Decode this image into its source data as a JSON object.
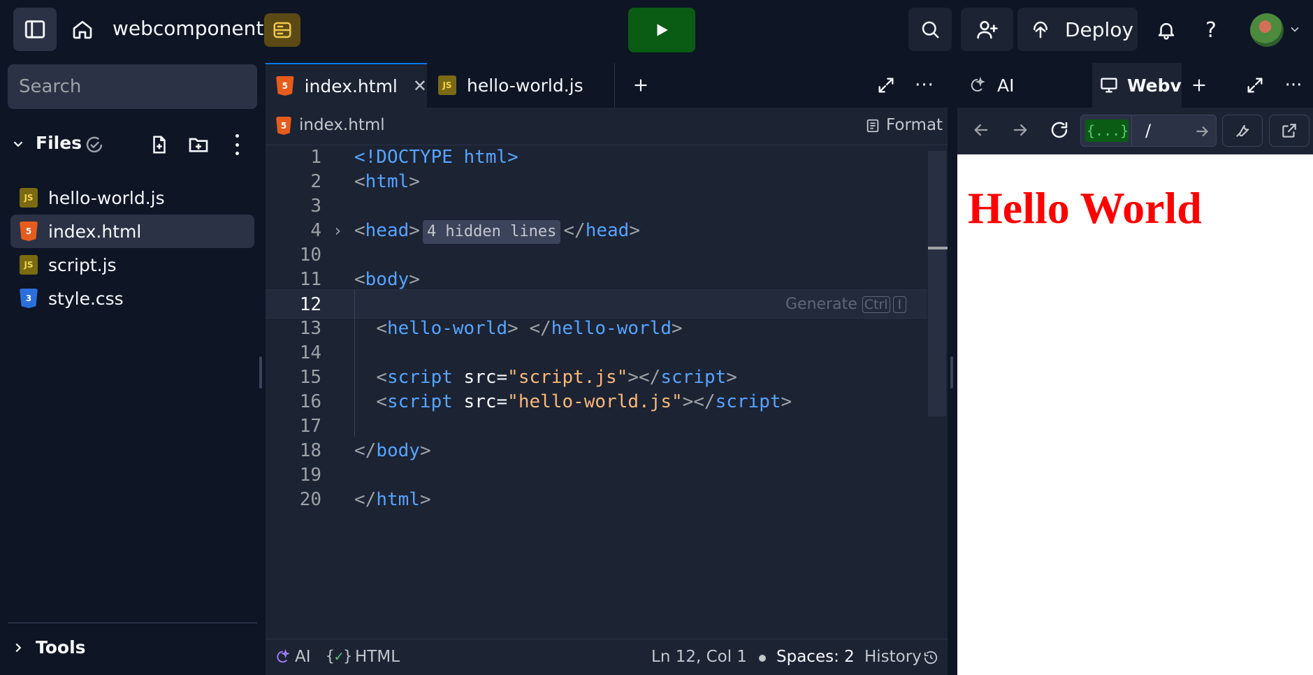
{
  "topbar": {
    "project_name": "webcomponent",
    "deploy_label": "Deploy",
    "run_color": "#0e6b1a"
  },
  "sidebar": {
    "search_placeholder": "Search",
    "files_label": "Files",
    "files": [
      {
        "name": "hello-world.js",
        "type": "js",
        "active": false
      },
      {
        "name": "index.html",
        "type": "html",
        "active": true
      },
      {
        "name": "script.js",
        "type": "js",
        "active": false
      },
      {
        "name": "style.css",
        "type": "css",
        "active": false
      }
    ],
    "tools_label": "Tools"
  },
  "editor": {
    "tabs": [
      {
        "label": "index.html",
        "icon": "html5-icon",
        "active": true
      },
      {
        "label": "hello-world.js",
        "icon": "js-icon",
        "active": false
      }
    ],
    "breadcrumb": "index.html",
    "format_label": "Format",
    "lines": [
      {
        "n": "1",
        "html": "<span class='tag'>&lt;!DOCTYPE html&gt;</span>"
      },
      {
        "n": "2",
        "html": "<span class='pun'>&lt;</span><span class='tag'>html</span><span class='pun'>&gt;</span>"
      },
      {
        "n": "3",
        "html": ""
      },
      {
        "n": "4",
        "html": "FOLD"
      },
      {
        "n": "10",
        "html": ""
      },
      {
        "n": "11",
        "html": "<span class='pun'>&lt;</span><span class='tag'>body</span><span class='pun'>&gt;</span>"
      },
      {
        "n": "12",
        "html": "CURRENT"
      },
      {
        "n": "13",
        "html": "  <span class='pun'>&lt;</span><span class='tag'>hello-world</span><span class='pun'>&gt; &lt;/</span><span class='tag'>hello-world</span><span class='pun'>&gt;</span>"
      },
      {
        "n": "14",
        "html": ""
      },
      {
        "n": "15",
        "html": "  <span class='pun'>&lt;</span><span class='tag'>script</span> <span class='attr'>src=</span><span class='str'>\"script.js\"</span><span class='pun'>&gt;&lt;/</span><span class='tag'>script</span><span class='pun'>&gt;</span>"
      },
      {
        "n": "16",
        "html": "  <span class='pun'>&lt;</span><span class='tag'>script</span> <span class='attr'>src=</span><span class='str'>\"hello-world.js\"</span><span class='pun'>&gt;&lt;/</span><span class='tag'>script</span><span class='pun'>&gt;</span>"
      },
      {
        "n": "17",
        "html": ""
      },
      {
        "n": "18",
        "html": "<span class='pun'>&lt;/</span><span class='tag'>body</span><span class='pun'>&gt;</span>"
      },
      {
        "n": "19",
        "html": ""
      },
      {
        "n": "20",
        "html": "<span class='pun'>&lt;/</span><span class='tag'>html</span><span class='pun'>&gt;</span>"
      }
    ],
    "fold_hidden_label": "4 hidden lines",
    "generate_label": "Generate",
    "generate_key_ctrl": "Ctrl",
    "generate_key_i": "I",
    "status": {
      "ai_label": "AI",
      "lang_label": "HTML",
      "cursor_pos": "Ln 12, Col 1",
      "spaces": "Spaces: 2",
      "history": "History"
    }
  },
  "right_pane": {
    "tabs": [
      {
        "label": "AI",
        "icon": "ai-sparkle-icon"
      },
      {
        "label": "Webv",
        "icon": "monitor-icon"
      }
    ],
    "url_prefix": "{...}.r",
    "url_path": "/",
    "preview_text": "Hello World"
  }
}
